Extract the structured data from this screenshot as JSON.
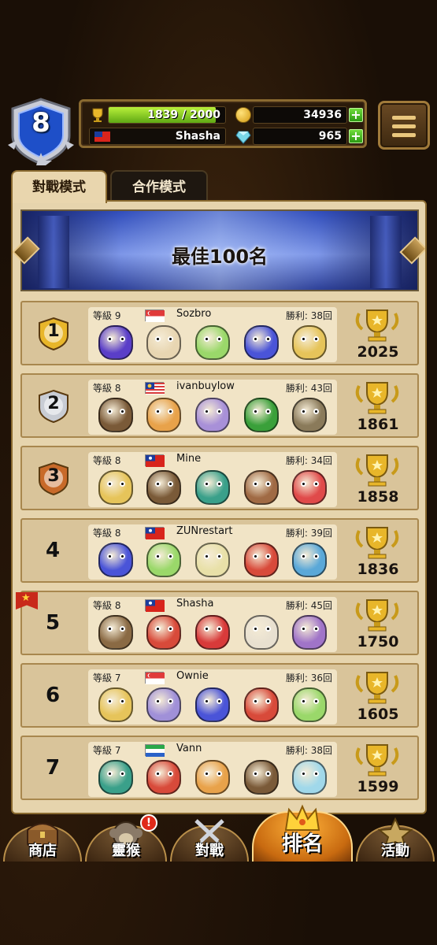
{
  "player": {
    "level": "8",
    "xp_text": "1839 / 2000",
    "xp_fraction": 0.92,
    "name": "Shasha",
    "flag": "taiwan",
    "coins": "34936",
    "gems": "965"
  },
  "tabs": [
    {
      "label": "對戰模式",
      "active": true
    },
    {
      "label": "合作模式",
      "active": false
    }
  ],
  "banner_title": "最佳100名",
  "rows": [
    {
      "rank": "1",
      "medal": "gold",
      "level": "等級 9",
      "flag": "singapore",
      "name": "Sozbro",
      "wins": "勝利: 38回",
      "score": "2025",
      "units": [
        "#5a3ec8",
        "#e8d6b2",
        "#9ad86a",
        "#4a54d8",
        "#e6c45a"
      ]
    },
    {
      "rank": "2",
      "medal": "silver",
      "level": "等級 8",
      "flag": "malaysia",
      "name": "ivanbuylow",
      "wins": "勝利: 43回",
      "score": "1861",
      "units": [
        "#7a5a38",
        "#e8a24a",
        "#a890d8",
        "#3aa03a",
        "#8a7a5a"
      ]
    },
    {
      "rank": "3",
      "medal": "bronze",
      "level": "等級 8",
      "flag": "taiwan",
      "name": "Mine",
      "wins": "勝利: 34回",
      "score": "1858",
      "units": [
        "#e6c45a",
        "#7a5a38",
        "#3aa08a",
        "#a06a44",
        "#e04a4a"
      ]
    },
    {
      "rank": "4",
      "medal": "none",
      "level": "等級 8",
      "flag": "taiwan",
      "name": "ZUNrestart",
      "wins": "勝利: 39回",
      "score": "1836",
      "units": [
        "#4a54d8",
        "#9ad86a",
        "#e8e0a8",
        "#d84a3a",
        "#5aa8d8"
      ]
    },
    {
      "rank": "5",
      "medal": "none",
      "level": "等級 8",
      "flag": "taiwan",
      "name": "Shasha",
      "wins": "勝利: 45回",
      "score": "1750",
      "units": [
        "#8a6a44",
        "#d84a3a",
        "#d83a3a",
        "#e8e0d0",
        "#a074c8"
      ]
    },
    {
      "rank": "6",
      "medal": "none",
      "level": "等級 7",
      "flag": "singapore",
      "name": "Ownie",
      "wins": "勝利: 36回",
      "score": "1605",
      "units": [
        "#e6c45a",
        "#a090d8",
        "#4a54d8",
        "#d84a3a",
        "#9ad86a"
      ]
    },
    {
      "rank": "7",
      "medal": "none",
      "level": "等級 7",
      "flag": "sierra-leone",
      "name": "Vann",
      "wins": "勝利: 38回",
      "score": "1599",
      "units": [
        "#3aa08a",
        "#d84a3a",
        "#e8a24a",
        "#7a5a38",
        "#a0d8ea"
      ]
    }
  ],
  "nav": [
    {
      "label": "商店",
      "icon": "chest-icon",
      "active": false,
      "alert": false
    },
    {
      "label": "靈猴",
      "icon": "monkey-icon",
      "active": false,
      "alert": true
    },
    {
      "label": "對戰",
      "icon": "crossed-swords-icon",
      "active": false,
      "alert": false
    },
    {
      "label": "排名",
      "icon": "crown-icon",
      "active": true,
      "alert": false
    },
    {
      "label": "活動",
      "icon": "star-icon",
      "active": false,
      "alert": false
    }
  ],
  "alert_symbol": "!",
  "colors": {
    "panel": "#e6d4ad",
    "row": "#d9c49a",
    "xp_bar": "#7cc41e",
    "nav_active": "#f59a22",
    "gold": "#e8b62a",
    "silver": "#c8ccd4",
    "bronze": "#c86a2a"
  }
}
